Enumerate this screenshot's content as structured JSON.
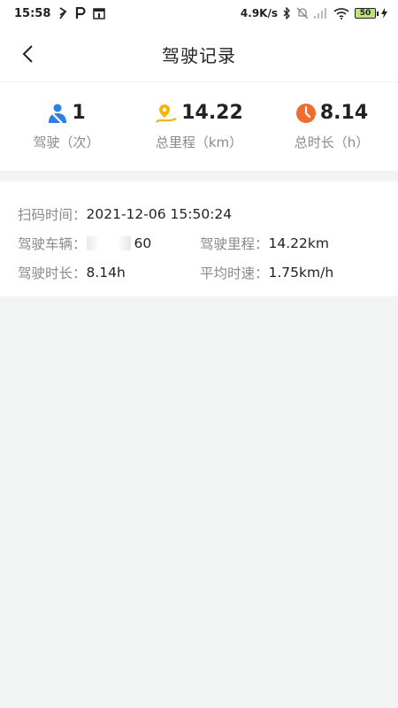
{
  "status_bar": {
    "time": "15:58",
    "net_speed": "4.9K/s",
    "battery": "50"
  },
  "header": {
    "title": "驾驶记录"
  },
  "stats": [
    {
      "icon": "seatbelt-person-icon",
      "value": "1",
      "label": "驾驶（次）",
      "color": "#2f7fe0"
    },
    {
      "icon": "map-pin-route-icon",
      "value": "14.22",
      "label": "总里程（km）",
      "color": "#f4b400"
    },
    {
      "icon": "clock-icon",
      "value": "8.14",
      "label": "总时长（h）",
      "color": "#f26a2e"
    }
  ],
  "record": {
    "scan_time_label": "扫码时间：",
    "scan_time": "2021-12-06 15:50:24",
    "vehicle_label": "驾驶车辆：",
    "vehicle": "60",
    "mileage_label": "驾驶里程：",
    "mileage": "14.22km",
    "duration_label": "驾驶时长：",
    "duration": "8.14h",
    "avg_speed_label": "平均时速：",
    "avg_speed": "1.75km/h"
  }
}
